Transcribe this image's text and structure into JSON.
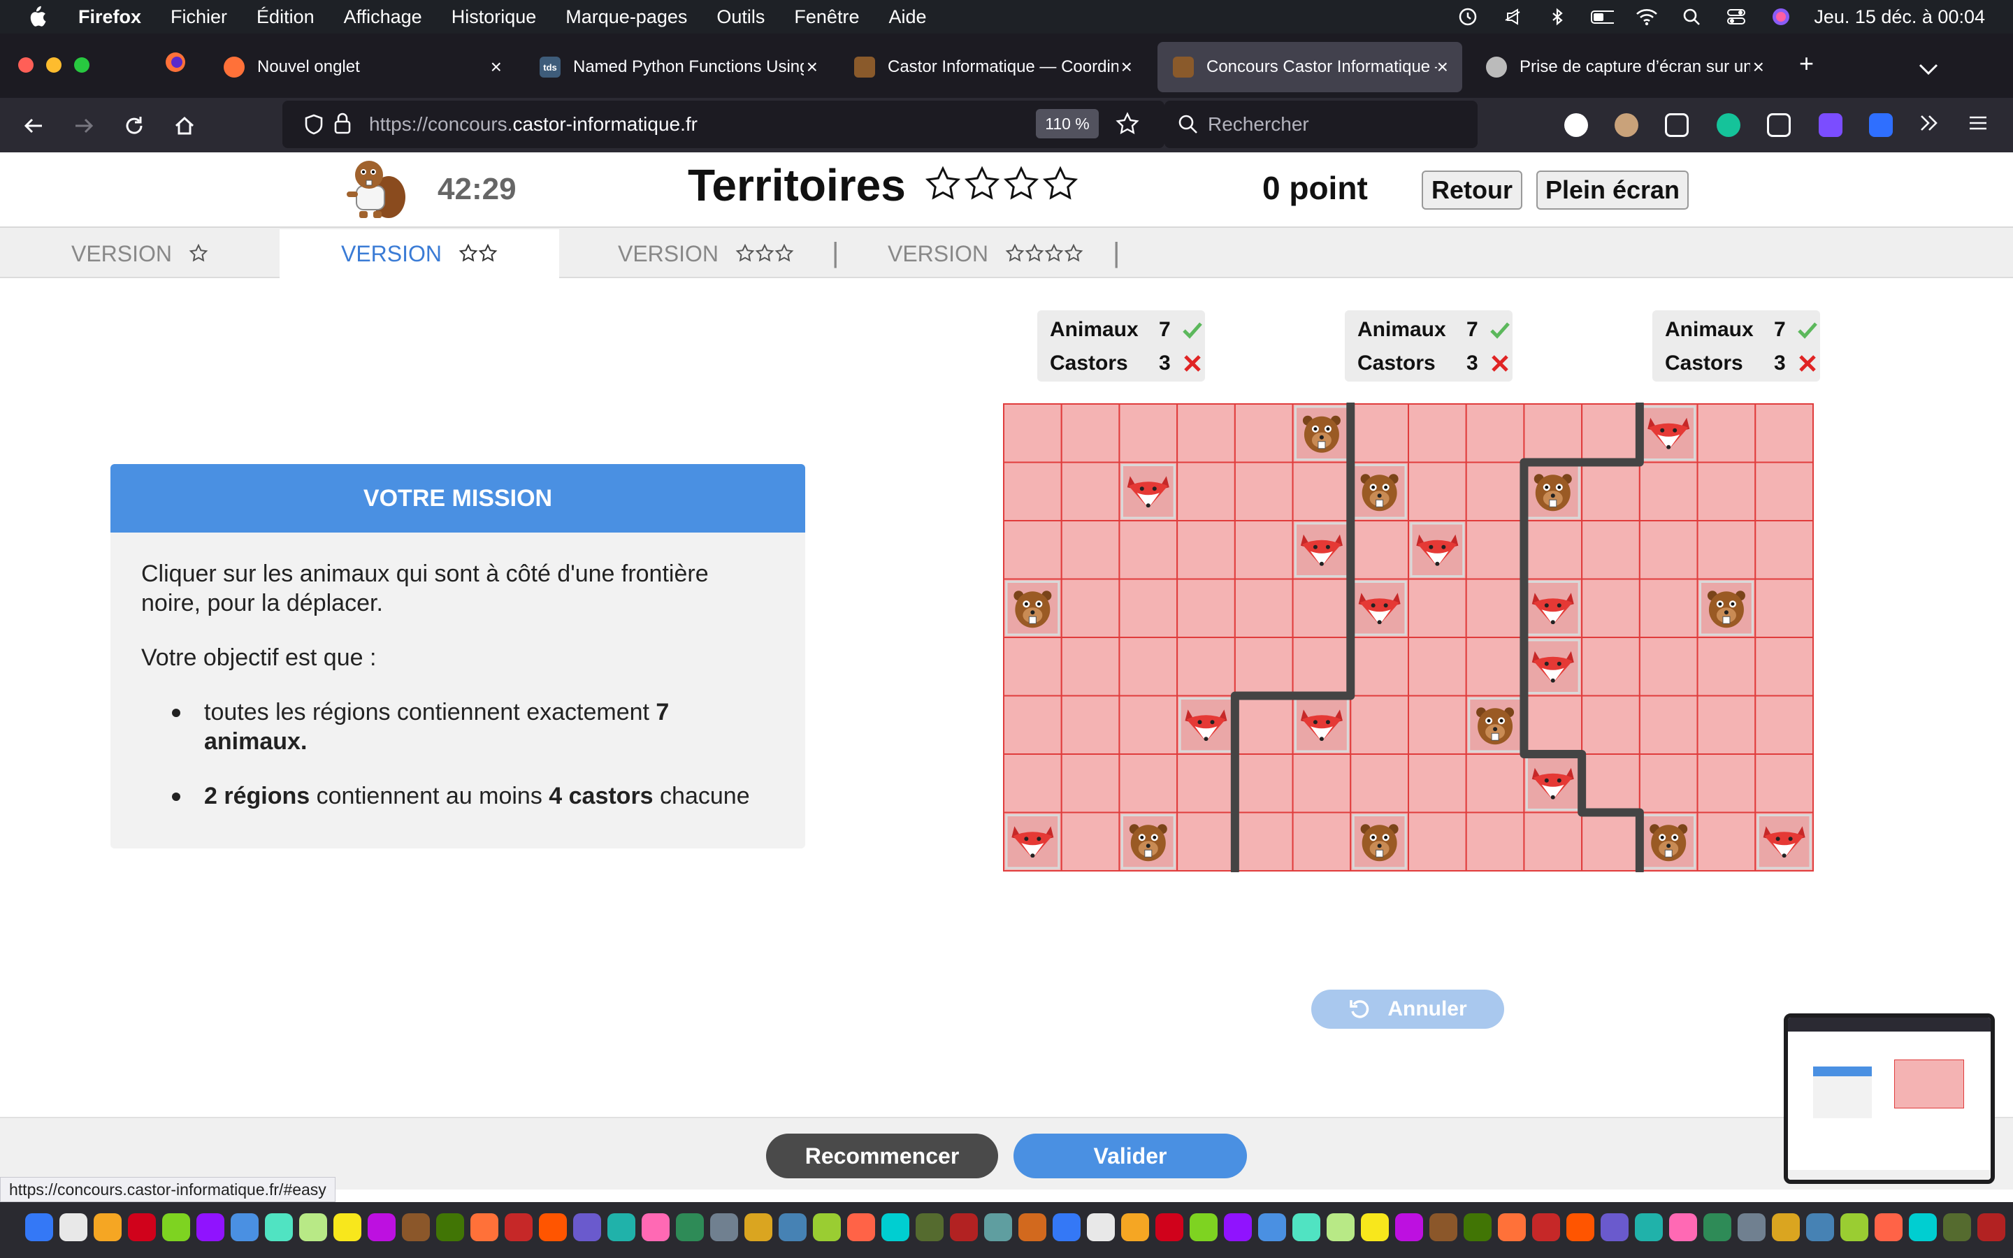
{
  "menubar": {
    "app": "Firefox",
    "items": [
      "Fichier",
      "Édition",
      "Affichage",
      "Historique",
      "Marque-pages",
      "Outils",
      "Fenêtre",
      "Aide"
    ],
    "clock": "Jeu. 15 déc. à  00:04"
  },
  "tabs": [
    {
      "label": "Nouvel onglet",
      "favicon_color": "#ff7139"
    },
    {
      "label": "Named Python Functions Using",
      "favicon_color": "#3e5c7a",
      "favicon_text": "tds"
    },
    {
      "label": "Castor Informatique — Coordina",
      "favicon_color": "#8a5a2b"
    },
    {
      "label": "Concours Castor Informatique –",
      "favicon_color": "#8a5a2b",
      "active": true
    },
    {
      "label": "Prise de capture d’écran sur un",
      "favicon_color": "#bbbbbb"
    }
  ],
  "nav": {
    "url_prefix": "https://concours.",
    "url_domain": "castor-informatique.fr",
    "zoom": "110 %",
    "search_placeholder": "Rechercher"
  },
  "header": {
    "timer": "42:29",
    "title": "Territoires",
    "title_stars": 4,
    "score": "0 point",
    "back_label": "Retour",
    "fullscreen_label": "Plein écran"
  },
  "versions": [
    {
      "label": "VERSION",
      "stars": 1
    },
    {
      "label": "VERSION",
      "stars": 2,
      "active": true
    },
    {
      "label": "VERSION",
      "stars": 3
    },
    {
      "label": "VERSION",
      "stars": 4
    }
  ],
  "version_separator": "|",
  "mission": {
    "title": "VOTRE MISSION",
    "p1": "Cliquer sur les animaux qui sont à côté d'une frontière noire, pour la déplacer.",
    "p2": "Votre objectif est que :",
    "b1_text": "toutes les régions contiennent exactement ",
    "b1_bold": "7 animaux.",
    "b2_bold1": "2 régions",
    "b2_text1": " contiennent au moins ",
    "b2_bold2": "4 castors",
    "b2_text2": " chacune"
  },
  "regions": [
    {
      "animals_label": "Animaux",
      "animals": "7",
      "animals_ok": true,
      "beavers_label": "Castors",
      "beavers": "3",
      "beavers_ok": false
    },
    {
      "animals_label": "Animaux",
      "animals": "7",
      "animals_ok": true,
      "beavers_label": "Castors",
      "beavers": "3",
      "beavers_ok": false
    },
    {
      "animals_label": "Animaux",
      "animals": "7",
      "animals_ok": true,
      "beavers_label": "Castors",
      "beavers": "3",
      "beavers_ok": false
    }
  ],
  "grid": {
    "cols": 14,
    "rows": 8,
    "cell_color": "#f4b3b3",
    "line_color": "#e03c3c",
    "border_color": "#444444",
    "animals": [
      {
        "col": 5,
        "row": 0,
        "kind": "beaver"
      },
      {
        "col": 11,
        "row": 0,
        "kind": "fox"
      },
      {
        "col": 2,
        "row": 1,
        "kind": "fox"
      },
      {
        "col": 6,
        "row": 1,
        "kind": "beaver"
      },
      {
        "col": 9,
        "row": 1,
        "kind": "beaver"
      },
      {
        "col": 5,
        "row": 2,
        "kind": "fox"
      },
      {
        "col": 7,
        "row": 2,
        "kind": "fox"
      },
      {
        "col": 0,
        "row": 3,
        "kind": "beaver"
      },
      {
        "col": 6,
        "row": 3,
        "kind": "fox"
      },
      {
        "col": 9,
        "row": 3,
        "kind": "fox"
      },
      {
        "col": 12,
        "row": 3,
        "kind": "beaver"
      },
      {
        "col": 9,
        "row": 4,
        "kind": "fox"
      },
      {
        "col": 3,
        "row": 5,
        "kind": "fox"
      },
      {
        "col": 5,
        "row": 5,
        "kind": "fox"
      },
      {
        "col": 8,
        "row": 5,
        "kind": "beaver"
      },
      {
        "col": 9,
        "row": 6,
        "kind": "fox"
      },
      {
        "col": 0,
        "row": 7,
        "kind": "fox"
      },
      {
        "col": 2,
        "row": 7,
        "kind": "beaver"
      },
      {
        "col": 6,
        "row": 7,
        "kind": "beaver"
      },
      {
        "col": 11,
        "row": 7,
        "kind": "beaver"
      },
      {
        "col": 13,
        "row": 7,
        "kind": "fox"
      }
    ],
    "borders": [
      [
        [
          6,
          0
        ],
        [
          6,
          5
        ],
        [
          4,
          5
        ],
        [
          4,
          8
        ]
      ],
      [
        [
          11,
          0
        ],
        [
          11,
          1
        ],
        [
          9,
          1
        ],
        [
          9,
          6
        ],
        [
          10,
          6
        ],
        [
          10,
          7
        ],
        [
          11,
          7
        ],
        [
          11,
          8
        ]
      ]
    ]
  },
  "undo_label": "Annuler",
  "restart_label": "Recommencer",
  "validate_label": "Valider",
  "status_url": "https://concours.castor-informatique.fr/#easy",
  "colors": {
    "accent": "#4a90e2",
    "check": "#5cb85c",
    "cross": "#e02424"
  }
}
